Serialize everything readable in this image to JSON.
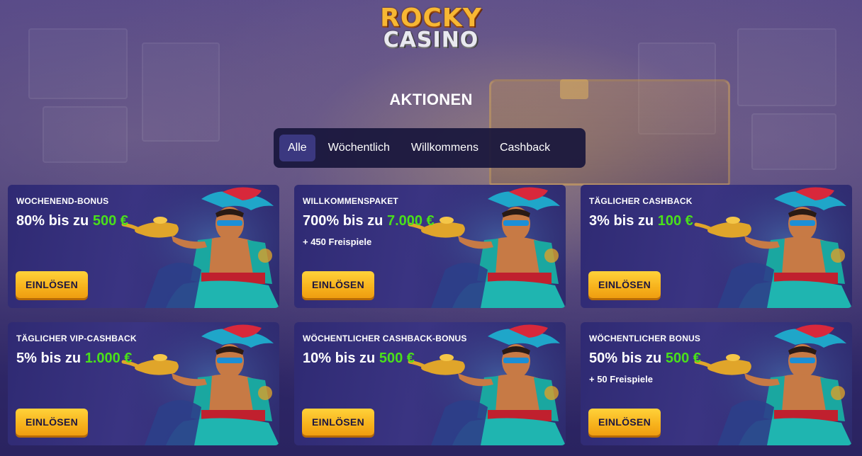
{
  "logo": {
    "line1": "ROCKY",
    "line2": "CASINO"
  },
  "page_title": "AKTIONEN",
  "tabs": [
    {
      "label": "Alle",
      "active": true
    },
    {
      "label": "Wöchentlich",
      "active": false
    },
    {
      "label": "Willkommens",
      "active": false
    },
    {
      "label": "Cashback",
      "active": false
    }
  ],
  "colors": {
    "accent_green": "#4ae01a",
    "button_yellow": "#f7b21c",
    "tab_active": "#3b3880"
  },
  "cards": [
    {
      "label": "WOCHENEND-BONUS",
      "offer_prefix": "80% bis zu",
      "offer_amount": "500 €",
      "extra": "",
      "button": "EINLÖSEN",
      "icon": "genie-with-lamp"
    },
    {
      "label": "WILLKOMMENSPAKET",
      "offer_prefix": "700% bis zu",
      "offer_amount": "7.000 €",
      "extra": "+ 450 Freispiele",
      "button": "EINLÖSEN",
      "icon": "genie-with-lamp"
    },
    {
      "label": "TÄGLICHER CASHBACK",
      "offer_prefix": "3% bis zu",
      "offer_amount": "100 €",
      "extra": "",
      "button": "EINLÖSEN",
      "icon": "genie-with-lamp"
    },
    {
      "label": "TÄGLICHER VIP-CASHBACK",
      "offer_prefix": "5% bis zu",
      "offer_amount": "1.000 €",
      "extra": "",
      "button": "EINLÖSEN",
      "icon": "genie-with-lamp"
    },
    {
      "label": "WÖCHENTLICHER CASHBACK-BONUS",
      "offer_prefix": "10% bis zu",
      "offer_amount": "500 €",
      "extra": "",
      "button": "EINLÖSEN",
      "icon": "genie-with-lamp"
    },
    {
      "label": "WÖCHENTLICHER BONUS",
      "offer_prefix": "50% bis zu",
      "offer_amount": "500 €",
      "extra": "+ 50 Freispiele",
      "button": "EINLÖSEN",
      "icon": "genie-with-lamp"
    }
  ]
}
